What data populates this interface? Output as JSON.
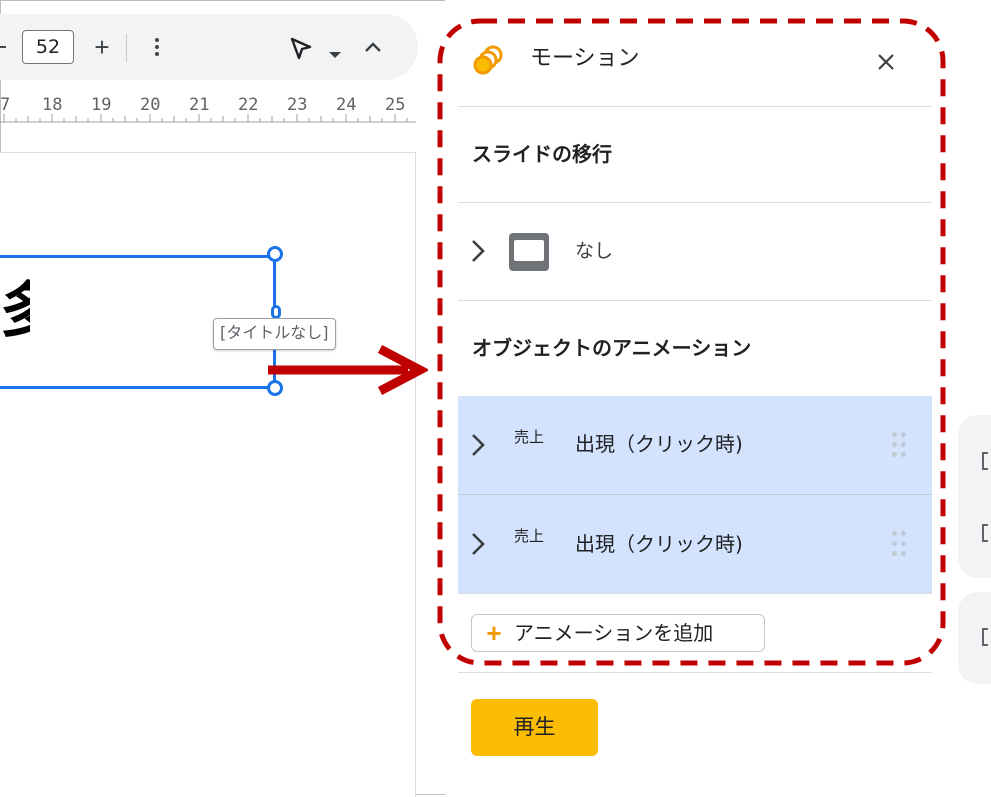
{
  "toolbar": {
    "zoom_value": "52",
    "zoom_in_glyph": "+",
    "icons": [
      "minus-icon",
      "plus-icon",
      "more-vert-icon",
      "select-cursor-icon",
      "caret-down-icon",
      "chevron-up-icon"
    ]
  },
  "ruler": {
    "partial_label": "7",
    "labels": [
      "18",
      "19",
      "20",
      "21",
      "22",
      "23",
      "24",
      "25"
    ]
  },
  "canvas": {
    "title_glyph": "多",
    "placeholder_tooltip": "[タイトルなし]"
  },
  "panel": {
    "title": "モーション",
    "close_icon": "close-icon",
    "logo_icon": "motion-logo-icon",
    "transition_section": "スライドの移行",
    "transition_value": "なし",
    "animation_section": "オブジェクトのアニメーション",
    "animations": [
      {
        "object": "売上",
        "label": "出現（クリック時)"
      },
      {
        "object": "売上",
        "label": "出現（クリック時)"
      }
    ],
    "add_animation": "アニメーションを追加",
    "play": "再生"
  },
  "colors": {
    "accent_blue": "#1a73e8",
    "highlight_row": "#d3e3fd",
    "annotation_red": "#c00000",
    "play_yellow": "#fbbc04",
    "motion_orange": "#f29900"
  }
}
